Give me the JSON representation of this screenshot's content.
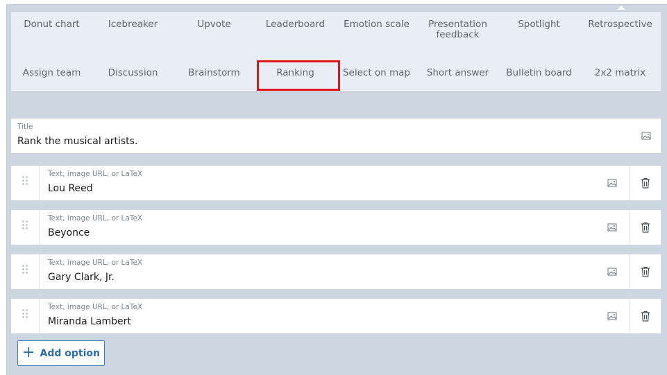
{
  "question_types": {
    "row1": [
      "Donut chart",
      "Icebreaker",
      "Upvote",
      "Leaderboard",
      "Emotion scale",
      "Presentation feedback",
      "Spotlight",
      "Retrospective"
    ],
    "row2": [
      "Assign team",
      "Discussion",
      "Brainstorm",
      "Ranking",
      "Select on map",
      "Short answer",
      "Bulletin board",
      "2x2 matrix"
    ],
    "selected": "Ranking"
  },
  "title_field": {
    "label": "Title",
    "value": "Rank the musical artists."
  },
  "options": [
    {
      "placeholder": "Text, image URL, or LaTeX",
      "value": "Lou Reed"
    },
    {
      "placeholder": "Text, image URL, or LaTeX",
      "value": "Beyonce"
    },
    {
      "placeholder": "Text, image URL, or LaTeX",
      "value": "Gary Clark, Jr."
    },
    {
      "placeholder": "Text, image URL, or LaTeX",
      "value": "Miranda Lambert"
    }
  ],
  "add_option": {
    "label": "Add option",
    "icon": "plus-icon"
  },
  "icons": {
    "image": "image-icon",
    "trash": "trash-icon",
    "drag": "drag-handle-icon"
  },
  "colors": {
    "highlight": "#e0141c",
    "accent": "#2e6da4",
    "panel": "#cdd5e0",
    "type_grid": "#e8eef5"
  }
}
